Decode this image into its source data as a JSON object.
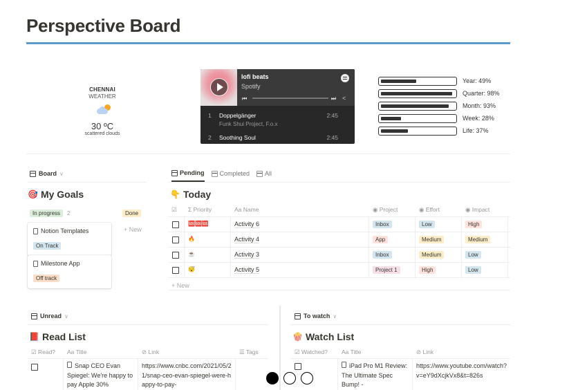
{
  "page": {
    "title": "Perspective Board"
  },
  "weather": {
    "city": "CHENNAI",
    "label": "WEATHER",
    "temperature": "30 ºC",
    "description": "scattered clouds",
    "icon": "partly-cloudy-icon"
  },
  "spotify": {
    "playlist": "lofi beats",
    "source": "Spotify",
    "tracks": [
      {
        "num": "1",
        "name": "Doppelgänger",
        "artist": "Funk Shui Project, F.o.x",
        "duration": "2:45"
      },
      {
        "num": "2",
        "name": "Soothing Soul",
        "artist": "",
        "duration": "2:45"
      }
    ]
  },
  "progress": [
    {
      "label": "Year: 49%",
      "value": 0.49
    },
    {
      "label": "Quarter: 98%",
      "value": 0.98
    },
    {
      "label": "Month: 93%",
      "value": 0.93
    },
    {
      "label": "Week: 28%",
      "value": 0.28
    },
    {
      "label": "Life: 37%",
      "value": 0.37
    }
  ],
  "goals": {
    "view_label": "Board",
    "title": "My Goals",
    "emoji": "🎯",
    "groups": [
      {
        "label": "In progress",
        "count": "2"
      },
      {
        "label": "Done",
        "count": ""
      }
    ],
    "new_label": "+ New",
    "cards": [
      {
        "title": "Notion Templates",
        "status": "On Track"
      },
      {
        "title": "Milestone App",
        "status": "Off track"
      }
    ]
  },
  "today": {
    "tabs": [
      {
        "label": "Pending",
        "active": true
      },
      {
        "label": "Completed",
        "active": false
      },
      {
        "label": "All",
        "active": false
      }
    ],
    "title": "Today",
    "emoji": "👇",
    "columns": [
      "Priority",
      "Name",
      "Project",
      "Effort",
      "Impact"
    ],
    "rows": [
      {
        "priority": "🆘🆘🆘",
        "name": "Activity 6",
        "project": "Inbox",
        "effort": "Low",
        "impact": "High"
      },
      {
        "priority": "🔥",
        "name": "Activity 4",
        "project": "App",
        "effort": "Medium",
        "impact": "Medium"
      },
      {
        "priority": "☕",
        "name": "Activity 3",
        "project": "Inbox",
        "effort": "Medium",
        "impact": "Low"
      },
      {
        "priority": "😴",
        "name": "Activity 5",
        "project": "Project 1",
        "effort": "High",
        "impact": "Low"
      }
    ],
    "new_label": "+ New"
  },
  "readlist": {
    "view_label": "Unread",
    "title": "Read List",
    "emoji": "📕",
    "columns": [
      "Read?",
      "Title",
      "Link",
      "Tags"
    ],
    "rows": [
      {
        "title": "Snap CEO Evan Spiegel: We're happy to pay Apple 30%",
        "link": "https://www.cnbc.com/2021/05/21/snap-ceo-evan-spiegel-were-happy-to-pay-"
      }
    ]
  },
  "watchlist": {
    "view_label": "To watch",
    "title": "Watch List",
    "emoji": "🍿",
    "columns": [
      "Watched?",
      "Title",
      "Link"
    ],
    "rows": [
      {
        "title": "iPad Pro M1 Review: The Ultimate Spec Bump! -",
        "link": "https://www.youtube.com/watch?v=eY9dXcjkVx8&t=826s"
      }
    ]
  },
  "pager": {
    "count": 3,
    "active": 0
  }
}
